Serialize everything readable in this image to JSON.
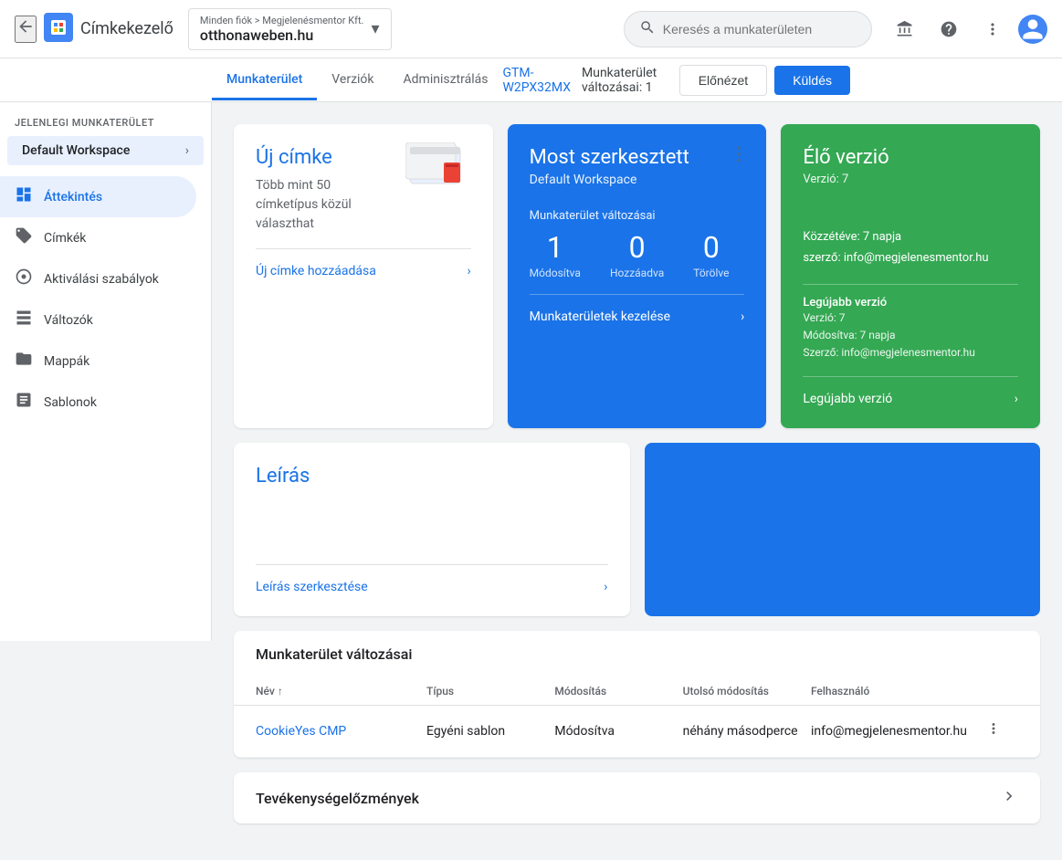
{
  "header": {
    "back_icon": "←",
    "app_title": "Címkekezelő",
    "breadcrumb": "Minden fiók > Megjelenésmentor Kft.",
    "domain": "otthonaweben.hu",
    "domain_chevron": "▾",
    "search_placeholder": "Keresés a munkaterületen",
    "apps_icon": "⋮⋮⋮",
    "help_icon": "?",
    "more_icon": "⋮",
    "avatar_letter": "👤"
  },
  "nav": {
    "tabs": [
      {
        "id": "munkaterulet",
        "label": "Munkaterület",
        "active": true
      },
      {
        "id": "verziok",
        "label": "Verziók",
        "active": false
      },
      {
        "id": "adminisztralas",
        "label": "Adminisztrálás",
        "active": false
      }
    ],
    "gtm_id": "GTM-W2PX32MX",
    "workspace_changes_label": "Munkaterület változásai: 1",
    "btn_preview": "Előnézet",
    "btn_publish": "Küldés"
  },
  "sidebar": {
    "section_label": "JELENLEGI MUNKATERÜLET",
    "workspace_name": "Default Workspace",
    "items": [
      {
        "id": "attekintes",
        "label": "Áttekintés",
        "icon": "📋",
        "active": true
      },
      {
        "id": "cimkek",
        "label": "Címkék",
        "icon": "🏷",
        "active": false
      },
      {
        "id": "aktivalasi_szabalyok",
        "label": "Aktiválási szabályok",
        "icon": "⊙",
        "active": false
      },
      {
        "id": "valtozok",
        "label": "Változók",
        "icon": "📊",
        "active": false
      },
      {
        "id": "mappak",
        "label": "Mappák",
        "icon": "📁",
        "active": false
      },
      {
        "id": "sablonok",
        "label": "Sablonok",
        "icon": "◱",
        "active": false
      }
    ]
  },
  "cards": {
    "new_tag": {
      "title": "Új címke",
      "subtitle": "Több mint 50 címketípus közül választhat",
      "link_label": "Új címke hozzáadása"
    },
    "most_edited": {
      "title": "Most szerkesztett",
      "subtitle": "Default Workspace",
      "changes_title": "Munkaterület változásai",
      "modified_count": "1",
      "added_count": "0",
      "deleted_count": "0",
      "modified_label": "Módosítva",
      "added_label": "Hozzáadva",
      "deleted_label": "Törölve",
      "link_label": "Munkaterületek kezelése",
      "dots": "⋮"
    },
    "live_version": {
      "title": "Élő verzió",
      "version_label": "Verzió: 7",
      "published_label": "Közzétéve: 7 napja",
      "author_label": "szerző: info@megjelenesmentor.hu",
      "latest_version_title": "Legújabb verzió",
      "latest_version_num": "Verzió: 7",
      "modified_label": "Módosítva: 7 napja",
      "author2_label": "Szerző: info@megjelenesmentor.hu",
      "link_label": "Legújabb verzió"
    },
    "description": {
      "title": "Leírás",
      "link_label": "Leírás szerkesztése"
    }
  },
  "changes_table": {
    "section_title": "Munkaterület változásai",
    "columns": [
      "Név",
      "Típus",
      "Módosítás",
      "Utolsó módosítás",
      "Felhasználó",
      ""
    ],
    "sort_col": "Név",
    "sort_icon": "↑",
    "rows": [
      {
        "name": "CookieYes CMP",
        "type": "Egyéni sablon",
        "modification": "Módosítva",
        "last_modified": "néhány másodperce",
        "user": "info@megjelenesmentor.hu"
      }
    ]
  },
  "activity": {
    "section_title": "Tevékenységelőzmények"
  }
}
